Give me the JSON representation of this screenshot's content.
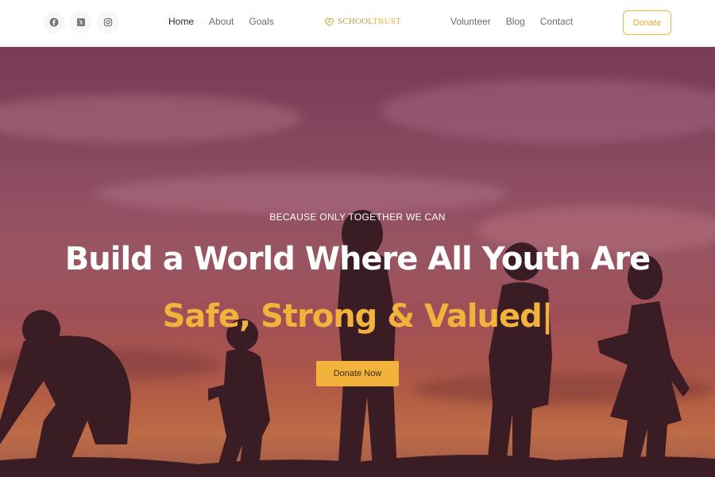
{
  "header": {
    "social": [
      {
        "icon": "facebook-icon"
      },
      {
        "icon": "x-twitter-icon"
      },
      {
        "icon": "instagram-icon"
      }
    ],
    "nav_left": [
      {
        "label": "Home",
        "active": true
      },
      {
        "label": "About",
        "active": false
      },
      {
        "label": "Goals",
        "active": false
      }
    ],
    "logo": {
      "part1": "SCHOOL",
      "part2": "TRUST",
      "icon": "heart-icon"
    },
    "nav_right": [
      {
        "label": "Volunteer"
      },
      {
        "label": "Blog"
      },
      {
        "label": "Contact"
      }
    ],
    "donate_label": "Donate"
  },
  "hero": {
    "tagline": "BECAUSE ONLY TOGETHER WE CAN",
    "headline_line1": "Build a World Where All Youth Are",
    "headline_line2": "Safe, Strong & Valued|",
    "cta_label": "Donate Now"
  },
  "colors": {
    "accent": "#f2b33d",
    "nav_text": "#6b6b6b",
    "nav_active": "#2c2c2c"
  }
}
